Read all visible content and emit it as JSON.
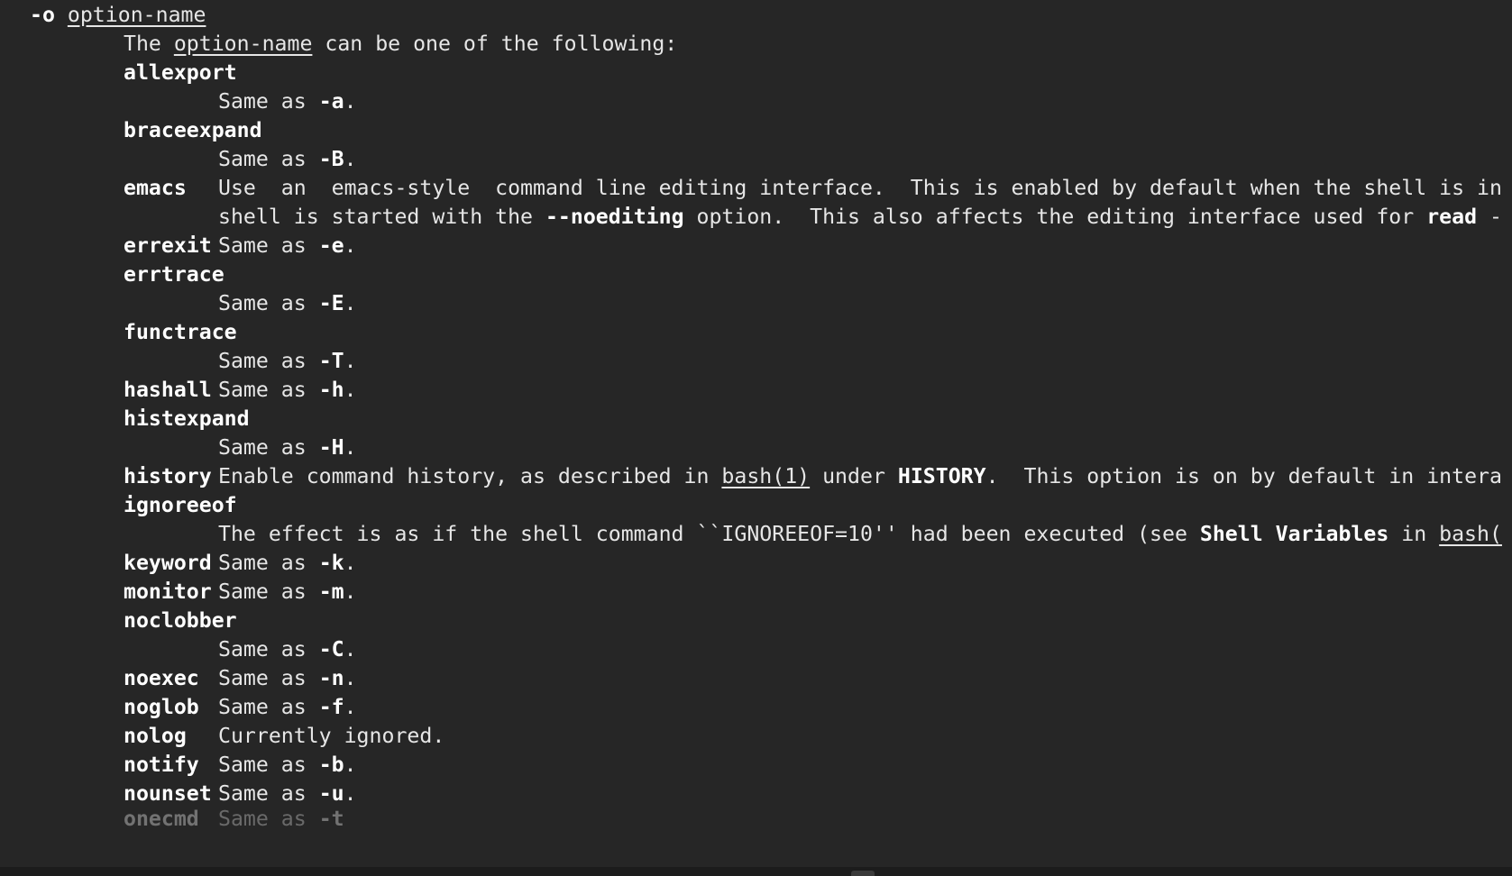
{
  "header": {
    "flag": "-o",
    "arg": "option-name"
  },
  "intro": {
    "pre": "The ",
    "arg": "option-name",
    "post": " can be one of the following:"
  },
  "options": {
    "allexport": {
      "name": "allexport",
      "pre": "Same as ",
      "flag": "-a",
      "post": "."
    },
    "braceexpand": {
      "name": "braceexpand",
      "pre": "Same as ",
      "flag": "-B",
      "post": "."
    },
    "emacs": {
      "name": "emacs",
      "line1": "Use  an  emacs-style  command line editing interface.  This is enabled by default when the shell is in",
      "line2_pre": "shell is started with the ",
      "line2_flag": "--noediting",
      "line2_mid": " option.  This also affects the editing interface used for ",
      "line2_read": "read",
      "line2_post": " -"
    },
    "errexit": {
      "name": "errexit",
      "pre": "Same as ",
      "flag": "-e",
      "post": "."
    },
    "errtrace": {
      "name": "errtrace",
      "pre": "Same as ",
      "flag": "-E",
      "post": "."
    },
    "functrace": {
      "name": "functrace",
      "pre": "Same as ",
      "flag": "-T",
      "post": "."
    },
    "hashall": {
      "name": "hashall",
      "pre": "Same as ",
      "flag": "-h",
      "post": "."
    },
    "histexpand": {
      "name": "histexpand",
      "pre": "Same as ",
      "flag": "-H",
      "post": "."
    },
    "history": {
      "name": "history",
      "pre": "Enable command history, as described in ",
      "ref": "bash(1)",
      "mid": " under ",
      "section": "HISTORY",
      "post": ".  This option is on by default in intera"
    },
    "ignoreeof": {
      "name": "ignoreeof",
      "pre": "The effect is as if the shell command ``IGNOREEOF=10'' had been executed (see ",
      "section": "Shell Variables",
      "mid": " in ",
      "ref": "bash("
    },
    "keyword": {
      "name": "keyword",
      "pre": "Same as ",
      "flag": "-k",
      "post": "."
    },
    "monitor": {
      "name": "monitor",
      "pre": "Same as ",
      "flag": "-m",
      "post": "."
    },
    "noclobber": {
      "name": "noclobber",
      "pre": "Same as ",
      "flag": "-C",
      "post": "."
    },
    "noexec": {
      "name": "noexec",
      "pre": "Same as ",
      "flag": "-n",
      "post": "."
    },
    "noglob": {
      "name": "noglob",
      "pre": "Same as ",
      "flag": "-f",
      "post": "."
    },
    "nolog": {
      "name": "nolog",
      "text": "Currently ignored."
    },
    "notify": {
      "name": "notify",
      "pre": "Same as ",
      "flag": "-b",
      "post": "."
    },
    "nounset": {
      "name": "nounset",
      "pre": "Same as ",
      "flag": "-u",
      "post": "."
    },
    "onecmd": {
      "name": "onecmd",
      "pre": "Same as ",
      "flag": "-t",
      "post": ""
    }
  },
  "colors": {
    "background": "#262626",
    "text": "#e6e6e6",
    "bold": "#ffffff"
  }
}
